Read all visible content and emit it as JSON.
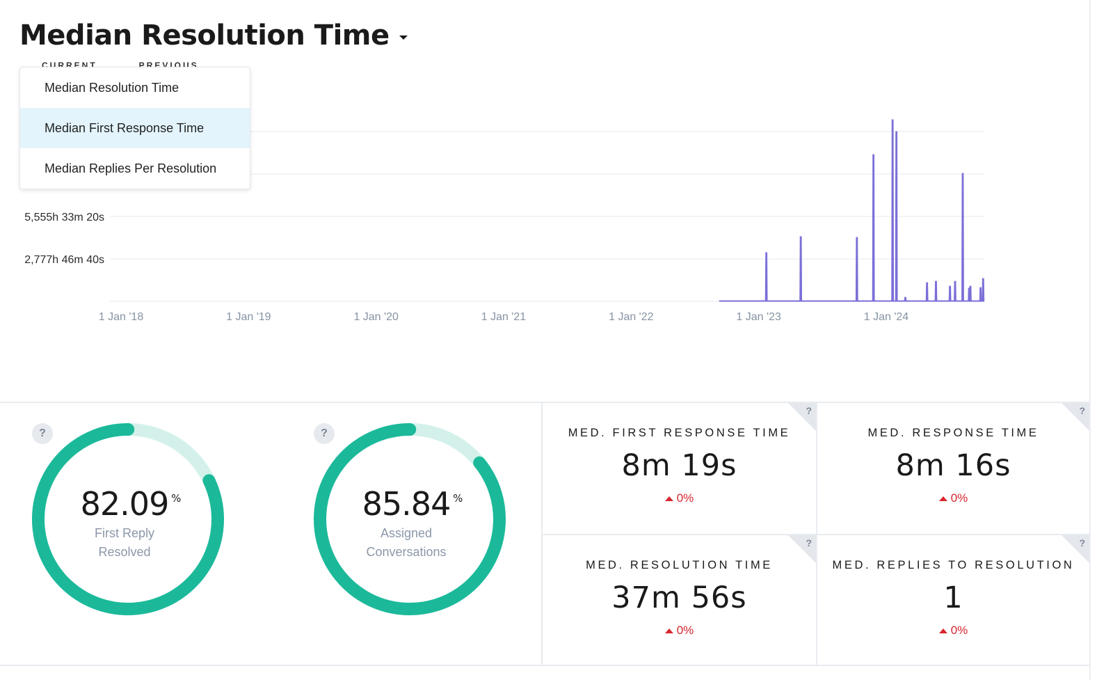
{
  "header": {
    "title": "Median Resolution Time",
    "legend_peek": [
      "CURRENT",
      "PREVIOUS"
    ]
  },
  "dropdown": {
    "items": [
      {
        "label": "Median Resolution Time",
        "active": false
      },
      {
        "label": "Median First Response Time",
        "active": true
      },
      {
        "label": "Median Replies Per Resolution",
        "active": false
      }
    ]
  },
  "chart_data": {
    "type": "line",
    "title": "Median Resolution Time",
    "xlabel": "",
    "ylabel": "",
    "color": "#7b6fd8",
    "grid": true,
    "y_unit": "hours",
    "ylim": [
      0,
      12000
    ],
    "y_ticks": [
      {
        "value": 0,
        "label": ""
      },
      {
        "value": 2777.78,
        "label": "2,777h 46m 40s"
      },
      {
        "value": 5555.56,
        "label": "5,555h 33m 20s"
      },
      {
        "value": 8333.33,
        "label": ""
      },
      {
        "value": 11111.11,
        "label": ""
      }
    ],
    "x_unit": "fractional year",
    "xlim": [
      2017.91,
      2024.95
    ],
    "x_ticks": [
      {
        "value": 2018,
        "label": "1 Jan '18"
      },
      {
        "value": 2019,
        "label": "1 Jan '19"
      },
      {
        "value": 2020,
        "label": "1 Jan '20"
      },
      {
        "value": 2021,
        "label": "1 Jan '21"
      },
      {
        "value": 2022,
        "label": "1 Jan '22"
      },
      {
        "value": 2023,
        "label": "1 Jan '23"
      },
      {
        "value": 2024,
        "label": "1 Jan '24"
      }
    ],
    "series": [
      {
        "name": "Current",
        "baseline_start": 2022.69,
        "baseline_end": 2024.76,
        "spikes": [
          {
            "x": 2023.03,
            "y": 60
          },
          {
            "x": 2023.06,
            "y": 3190
          },
          {
            "x": 2023.33,
            "y": 4240
          },
          {
            "x": 2023.56,
            "y": 40
          },
          {
            "x": 2023.77,
            "y": 4190
          },
          {
            "x": 2023.9,
            "y": 9610
          },
          {
            "x": 2024.05,
            "y": 11890
          },
          {
            "x": 2024.08,
            "y": 11110
          },
          {
            "x": 2024.15,
            "y": 270
          },
          {
            "x": 2024.32,
            "y": 1230
          },
          {
            "x": 2024.39,
            "y": 1320
          },
          {
            "x": 2024.5,
            "y": 1000
          },
          {
            "x": 2024.54,
            "y": 1320
          },
          {
            "x": 2024.6,
            "y": 8380
          },
          {
            "x": 2024.65,
            "y": 870
          },
          {
            "x": 2024.66,
            "y": 1000
          },
          {
            "x": 2024.74,
            "y": 910
          },
          {
            "x": 2024.76,
            "y": 1500
          }
        ]
      }
    ]
  },
  "gauges": [
    {
      "value": "82.09",
      "unit": "%",
      "percent": 82.09,
      "label_lines": [
        "First Reply",
        "Resolved"
      ],
      "help": "?"
    },
    {
      "value": "85.84",
      "unit": "%",
      "percent": 85.84,
      "label_lines": [
        "Assigned",
        "Conversations"
      ],
      "help": "?"
    }
  ],
  "stats": [
    {
      "title": "MED. FIRST RESPONSE TIME",
      "value": "8m 19s",
      "delta": "0%",
      "help": "?"
    },
    {
      "title": "MED. RESPONSE TIME",
      "value": "8m 16s",
      "delta": "0%",
      "help": "?"
    },
    {
      "title": "MED. RESOLUTION TIME",
      "value": "37m 56s",
      "delta": "0%",
      "help": "?"
    },
    {
      "title": "MED. REPLIES TO RESOLUTION",
      "value": "1",
      "delta": "0%",
      "help": "?"
    }
  ],
  "colors": {
    "series": "#7b6fd8",
    "gauge_fill": "#1bb99a",
    "gauge_track": "#d3f1ea",
    "delta_negative": "#d7262e"
  }
}
